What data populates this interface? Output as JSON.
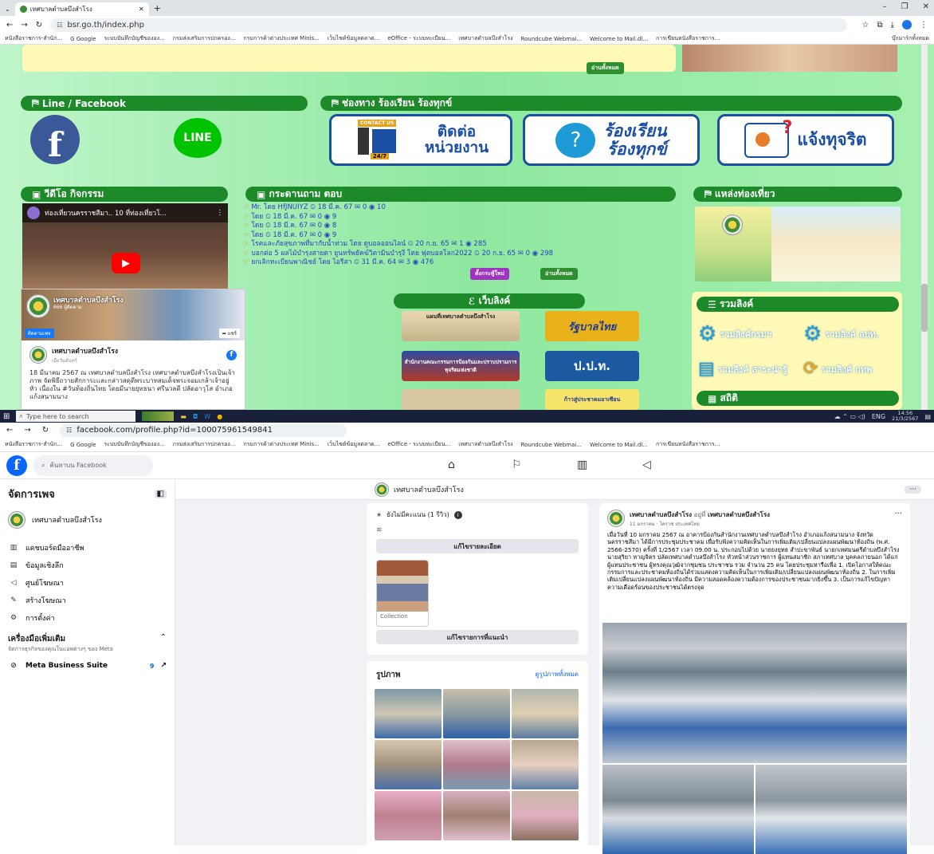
{
  "browser1": {
    "tab_title": "เทศบาลตำบลบึงสำโรง",
    "url": "bsr.go.th/index.php",
    "bookmarks": [
      "หนังสือราชการ-สำนัก...",
      "G Google",
      "ระบบบันทึกบัญชีขององ...",
      "กรมส่งเสริมการปกครอง...",
      "กรมการค้าต่างประเทศ Minis...",
      "เว็บไซต์ข้อมูลตลาด...",
      "eOffice - ระบบทะเบียน...",
      "เทศบาลตำบลบึงสำโรง",
      "Roundcube Webmai...",
      "Welcome to Mail.dl...",
      "การเขียนหนังสือราชการ..."
    ],
    "all_bookmarks": "บุ๊กมาร์กทั้งหมด"
  },
  "site": {
    "read_all": "อ่านทั้งหมด",
    "line_fb_header": "Line / Facebook",
    "line_label": "LINE",
    "complaint_header": "ช่องทาง ร้องเรียน ร้องทุกข์",
    "card_contact": "ติดต่อ\nหน่วยงาน",
    "card_contact_tag": "CONTACT US",
    "card_contact_247": "24/7",
    "card_complain": "ร้องเรียน\nร้องทุกข์",
    "card_corrupt": "แจ้งทุจริต",
    "video_header": "วีดีโอ กิจกรรม",
    "video_title": "ท่องเที่ยวนครราชสีมา.. 10 ที่ท่องเที่ยวโ...",
    "qa_header": "กระดานถาม ตอบ",
    "qa_rows": [
      "Mr. โดย HfJNUIYZ ⏲ 18 มี.ค. 67 ✉ 0 ◉ 10",
      "โดย ⏲ 18 มี.ค. 67 ✉ 0 ◉ 9",
      "โดย ⏲ 18 มี.ค. 67 ✉ 0 ◉ 8",
      "โดย ⏲ 18 มี.ค. 67 ✉ 0 ◉ 9",
      "โรคและภัยสุขภาพที่มากับน้ำท่วม โดย ดูบอลออนไลน์ ⏲ 20 ก.ย. 65 ✉ 1 ◉ 285",
      "บอกต่อ 5 ผลไม้บำรุงสายตา ยูนทร์พยัคฆ์วิตามินบำรุงี โดย ฟุตบอลโลก2022 ⏲ 20 ก.ย. 65 ✉ 0 ◉ 298",
      "ยกเลิกทะเบียนพาณิชย์ โดย ไอรีสา ⏲ 31 มี.ค. 64 ✉ 3 ◉ 476"
    ],
    "qa_new": "ตั้งกระทู้ใหม่",
    "qa_all": "อ่านทั้งหมด",
    "tour_header": "แหล่งท่องเที่ยว",
    "fb_page_name": "เทศบาลตำบลบึงสำโรง",
    "fb_likes": "666 ผู้ติดตาม",
    "fb_follow": "ติดตามเพจ",
    "fb_share": "แชร์",
    "fb_post_author": "เทศบาลตำบลบึงสำโรง",
    "fb_post_sub": "เมื่อวันจันทร์",
    "fb_post_text": "18 มีนาคม 2567 ณ เทศบาลตำบลบึงสำโรง เทศบาลตำบลบึงสำโรงเป็นเจ้าภาพ จัดพิธีถวายสักการะและกล่าวสดุดีพระบาทสมเด็จพระจอมเกล้าเจ้าอยู่หัว เนื่องใน #วันท้องถิ่นไทย โดยมีนายยุทธนา ศรีนวลดี ปลัดอาวุโส อำเภอแก้งสนามนาง",
    "weblink_header": "เว็บลิงค์",
    "weblink_map": "แผนที่เทศบาลตำบลบึงสำโรง",
    "weblink_gov": "รัฐบาลไทย",
    "weblink_nacc": "สำนักงานคณะกรรมการป้องกันและปราบปรามการทุจริตแห่งชาติ",
    "weblink_pacc": "ป.ป.ท.",
    "weblink_asean": "ก้าวสู่ประชาคมอาเซียน",
    "links_header": "รวมลิงค์",
    "link_1": "รวมลิงค์กรมฯ",
    "link_2": "รวมลิงค์ อปท.",
    "link_3": "รวมลิงค์ สาระน่ารู้",
    "link_4": "รวมลิงค์ กทพ",
    "stats_header": "สถิติ"
  },
  "taskbar": {
    "search": "Type here to search",
    "lang": "ENG",
    "time": "14:56",
    "date": "21/3/2567"
  },
  "browser2": {
    "url": "facebook.com/profile.php?id=100075961549841"
  },
  "facebook": {
    "search_placeholder": "ค้นหาบน Facebook",
    "sidebar_title": "จัดการเพจ",
    "page_name": "เทศบาลตำบลบึงสำโรง",
    "menu": [
      "แดชบอร์ดมืออาชีพ",
      "ข้อมูลเชิงลึก",
      "ศูนย์โฆษณา",
      "สร้างโฆษณา",
      "การตั้งค่า"
    ],
    "tools_title": "เครื่องมือเพิ่มเติม",
    "tools_sub": "จัดการธุรกิจของคุณในแอพต่างๆ ของ Meta",
    "mbs": "Meta Business Suite",
    "mbs_count": "9",
    "rating": "ยังไม่มีคะแนน (1 รีวิว)",
    "edit_details": "แก้ไขรายละเอียด",
    "collection": "Collection",
    "edit_featured": "แก้ไขรายการที่แนะนำ",
    "photos_title": "รูปภาพ",
    "see_all_photos": "ดูรูปภาพทั้งหมด",
    "post_author": "เทศบาลตำบลบึงสำโรง",
    "post_at": "อยู่ที่",
    "post_place": "เทศบาลตำบลบึงสำโรง",
    "post_time": "11 มกราคม · โคราช ประเทศไทย",
    "post_text": "เมื่อวันที่ 10 มกราคม 2567 ณ อาคารป้องกันสำนักงานเทศบาลตำบลบึงสำโรง อำเภอแก้งสนามนาง จังหวัดนครราชสีมา ได้มีการประชุมประชาคม เพื่อรับฟังความคิดเห็นในการเพิ่มเติม/เปลี่ยนแปลงแผนพัฒนาท้องถิ่น (พ.ศ. 2566-2570) ครั้งที่ 1/2567 เวลา 09.00 น. ประกอบไปด้วย นายยงยุทธ สำปะขาพันธ์ นายกเทศมนตรีตำบลบึงสำโรง นายสุริยา หาญจิตร ปลัดเทศบาลตำบลบึงสำโรง หัวหน้าส่วนราชการ ผู้แทนสมาชิก สภาเทศบาล บุคคลภายนอก ได้แก่ ผู้แทนประชาชน ผู้ทรงคุณวุฒิจากชุมชน ประชาชน รวม จำนวน 25 คน โดยประชุมหารือเพื่อ 1. เปิดโอกาสให้คณะกรรมการและประชาคมท้องถิ่นได้ร่วมแสดงความคิดเห็นในการเพิ่มเติม/เปลี่ยนแปลงแผนพัฒนาท้องถิ่น 2. ในการเพิ่มเติมเปลี่ยนแปลงแผนพัฒนาท้องถิ่น มีความสอดคล้องความต้องการของประชาชนมากยิ่งขึ้น 3. เป็นการแก้ไขปัญหาความเดือดร้อนของประชาชนได้ตรงจุด"
  }
}
